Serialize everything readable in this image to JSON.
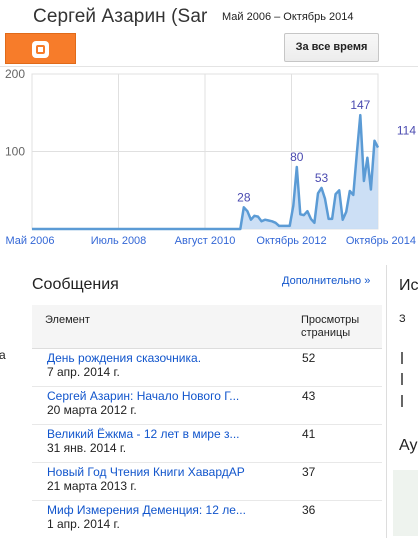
{
  "header": {
    "blog_title": "Сергей Азарин (Sar",
    "date_range": "Май 2006 – Октябрь 2014",
    "period_button": "За все время"
  },
  "icons": {
    "blogger": "blogger-logo-icon"
  },
  "colors": {
    "accent": "#f77c2a",
    "link": "#1155cc",
    "chart_line": "#5b9bd5",
    "chart_fill": "#c6dcf4"
  },
  "chart_data": {
    "type": "area",
    "x_labels": [
      "Май 2006",
      "Июль 2008",
      "Август 2010",
      "Октябрь 2012",
      "Октябрь 2014"
    ],
    "y_ticks": [
      100,
      200
    ],
    "ylim": [
      0,
      200
    ],
    "grid": true,
    "values": [
      0,
      0,
      0,
      0,
      0,
      0,
      0,
      0,
      0,
      0,
      0,
      0,
      0,
      0,
      0,
      0,
      0,
      0,
      0,
      0,
      0,
      0,
      0,
      0,
      0,
      0,
      0,
      0,
      0,
      0,
      0,
      0,
      0,
      0,
      0,
      0,
      0,
      0,
      0,
      0,
      0,
      0,
      0,
      0,
      0,
      0,
      0,
      0,
      0,
      0,
      0,
      0,
      0,
      0,
      0,
      0,
      0,
      0,
      0,
      0,
      28,
      23,
      12,
      17,
      16,
      10,
      12,
      11,
      10,
      8,
      4,
      4,
      4,
      4,
      30,
      80,
      19,
      18,
      23,
      13,
      8,
      46,
      53,
      39,
      13,
      13,
      45,
      50,
      12,
      22,
      49,
      44,
      97,
      147,
      62,
      92,
      51,
      114,
      105
    ],
    "point_labels": [
      {
        "value": 28,
        "label": "28"
      },
      {
        "value": 80,
        "label": "80"
      },
      {
        "value": 53,
        "label": "53"
      },
      {
        "value": 147,
        "label": "147"
      },
      {
        "value": 114,
        "label": "114"
      }
    ]
  },
  "posts": {
    "title": "Сообщения",
    "more_link": "Дополнительно »",
    "col_element": "Элемент",
    "col_views": "Просмотры страницы",
    "rows": [
      {
        "title": "День рождения сказочника.",
        "date": "7 апр. 2014 г.",
        "views": "52"
      },
      {
        "title": "Сергей Азарин: Начало Нового Г...",
        "date": "20 марта 2012 г.",
        "views": "43"
      },
      {
        "title": "Великий Ёжкма - 12 лет в мире з...",
        "date": "31 янв. 2014 г.",
        "views": "41"
      },
      {
        "title": "Новый Год Чтения Книги ХавардАР",
        "date": "21 марта 2013 г.",
        "views": "37"
      },
      {
        "title": "Миф Измерения Деменция: 12 ле...",
        "date": "1 апр. 2014 г.",
        "views": "36"
      }
    ]
  },
  "left_fragment": "а",
  "right_panel": {
    "title": "Ис",
    "sub": "З",
    "title2": "Ау"
  }
}
